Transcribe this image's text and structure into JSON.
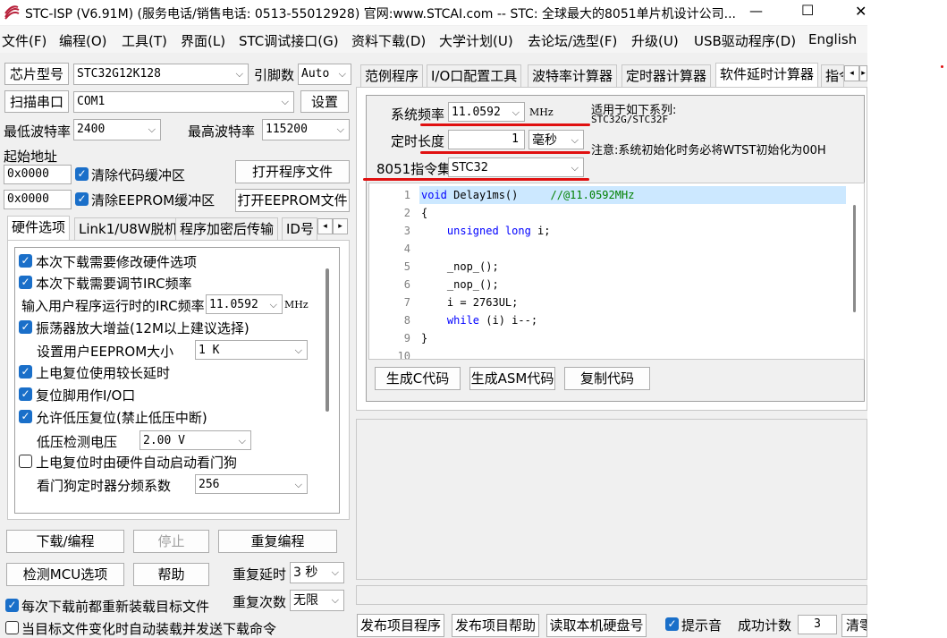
{
  "window": {
    "title": "STC-ISP (V6.91M) (服务电话/销售电话: 0513-55012928) 官网:www.STCAI.com  -- STC: 全球最大的8051单片机设计公司...",
    "min": "—",
    "max": "☐",
    "close": "✕"
  },
  "menu": [
    "文件(F)",
    "编程(O)",
    "工具(T)",
    "界面(L)",
    "STC调试接口(G)",
    "资料下载(D)",
    "大学计划(U)",
    "去论坛/选型(F)",
    "升级(U)",
    "USB驱动程序(D)",
    "English"
  ],
  "left": {
    "chip_label": "芯片型号",
    "chip_value": "STC32G12K128",
    "pin_label": "引脚数",
    "pin_value": "Auto",
    "scan_btn": "扫描串口",
    "port_value": "COM1",
    "settings_btn": "设置",
    "min_baud_label": "最低波特率",
    "min_baud": "2400",
    "max_baud_label": "最高波特率",
    "max_baud": "115200",
    "start_addr_label": "起始地址",
    "addr1": "0x0000",
    "clear_code": "清除代码缓冲区",
    "open_prog": "打开程序文件",
    "addr2": "0x0000",
    "clear_eeprom": "清除EEPROM缓冲区",
    "open_eeprom": "打开EEPROM文件",
    "tabs": [
      "硬件选项",
      "Link1/U8W脱机",
      "程序加密后传输",
      "ID号"
    ],
    "options": {
      "opt1": "本次下载需要修改硬件选项",
      "opt2": "本次下载需要调节IRC频率",
      "irc_label": "输入用户程序运行时的IRC频率",
      "irc_value": "11.0592",
      "irc_unit": "MHz",
      "opt3": "振荡器放大增益(12M以上建议选择)",
      "eeprom_label": "设置用户EEPROM大小",
      "eeprom_value": "1   K",
      "opt4": "上电复位使用较长延时",
      "opt5": "复位脚用作I/O口",
      "opt6": "允许低压复位(禁止低压中断)",
      "lv_label": "低压检测电压",
      "lv_value": "2.00 V",
      "opt7": "上电复位时由硬件自动启动看门狗",
      "wdt_label": "看门狗定时器分频系数",
      "wdt_value": "256"
    },
    "download_btn": "下载/编程",
    "stop_btn": "停止",
    "reprogram_btn": "重复编程",
    "detect_btn": "检测MCU选项",
    "help_btn": "帮助",
    "repeat_delay_label": "重复延时",
    "repeat_delay": "3 秒",
    "repeat_count_label": "重复次数",
    "repeat_count": "无限",
    "reload_each": "每次下载前都重新装载目标文件",
    "auto_reload": "当目标文件变化时自动装载并发送下载命令"
  },
  "right": {
    "tabs": [
      "范例程序",
      "I/O口配置工具",
      "波特率计算器",
      "定时器计算器",
      "软件延时计算器",
      "指令"
    ],
    "tab_nav": "◂▸",
    "sysfreq_label": "系统频率",
    "sysfreq_value": "11.0592",
    "sysfreq_unit": "MHz",
    "applies_to": "适用于如下系列:",
    "series": "STC32G/STC32F",
    "timelen_label": "定时长度",
    "timelen_value": "1",
    "timelen_unit": "毫秒",
    "note": "注意:系统初始化时务必将WTST初始化为00H",
    "isa_label": "8051指令集",
    "isa_value": "STC32",
    "code": [
      {
        "n": "1",
        "parts": [
          {
            "t": "void",
            "c": "kw"
          },
          {
            "t": " Delay1ms()     ",
            "c": ""
          },
          {
            "t": "//@11.0592MHz",
            "c": "cm"
          }
        ]
      },
      {
        "n": "2",
        "parts": [
          {
            "t": "{",
            "c": ""
          }
        ]
      },
      {
        "n": "3",
        "parts": [
          {
            "t": "    ",
            "c": ""
          },
          {
            "t": "unsigned long",
            "c": "kw"
          },
          {
            "t": " i;",
            "c": ""
          }
        ]
      },
      {
        "n": "4",
        "parts": []
      },
      {
        "n": "5",
        "parts": [
          {
            "t": "    _nop_();",
            "c": ""
          }
        ]
      },
      {
        "n": "6",
        "parts": [
          {
            "t": "    _nop_();",
            "c": ""
          }
        ]
      },
      {
        "n": "7",
        "parts": [
          {
            "t": "    i = 2763UL;",
            "c": ""
          }
        ]
      },
      {
        "n": "8",
        "parts": [
          {
            "t": "    ",
            "c": ""
          },
          {
            "t": "while",
            "c": "kw"
          },
          {
            "t": " (i) i--;",
            "c": ""
          }
        ]
      },
      {
        "n": "9",
        "parts": [
          {
            "t": "}",
            "c": ""
          }
        ]
      },
      {
        "n": "10",
        "parts": []
      }
    ],
    "gen_c": "生成C代码",
    "gen_asm": "生成ASM代码",
    "copy": "复制代码",
    "publish_prog": "发布项目程序",
    "publish_help": "发布项目帮助",
    "read_disk": "读取本机硬盘号",
    "beep": "提示音",
    "success_label": "成功计数",
    "success_count": "3",
    "clear": "清零"
  },
  "colors": {
    "accent": "#1a6fc9",
    "annotation": "#e01010",
    "keyword": "#0000ff",
    "comment": "#008000"
  }
}
